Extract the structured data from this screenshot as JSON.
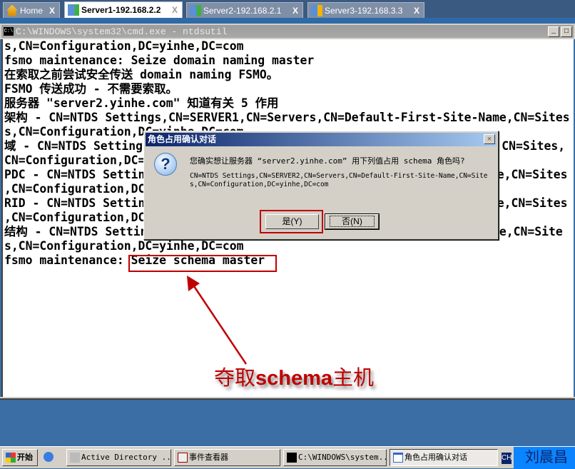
{
  "tabs": [
    {
      "label": "Home",
      "icon": "home-icon"
    },
    {
      "label": "Server1-192.168.2.2",
      "icon": "server-running-icon",
      "active": true
    },
    {
      "label": "Server2-192.168.2.1",
      "icon": "server-running-icon"
    },
    {
      "label": "Server3-192.168.3.3",
      "icon": "server-paused-icon"
    }
  ],
  "tab_close": "X",
  "cmd": {
    "title": "C:\\WINDOWS\\system32\\cmd.exe - ntdsutil",
    "icon_text": "C:\\",
    "lines": [
      "s,CN=Configuration,DC=yinhe,DC=com",
      "fsmo maintenance: Seize domain naming master",
      "在索取之前尝试安全传送 domain naming FSMO。",
      "FSMO 传送成功 - 不需要索取。",
      "服务器 \"server2.yinhe.com\" 知道有关 5 作用",
      "架构 - CN=NTDS Settings,CN=SERVER1,CN=Servers,CN=Default-First-Site-Name,CN=Sites",
      "s,CN=Configuration,DC=yinhe,DC=com",
      "域 - CN=NTDS Settings,CN=SERVER1,CN=Servers,CN=Default-First-Site-Name,CN=Sites,",
      "CN=Configuration,DC=yinhe,DC=com",
      "PDC - CN=NTDS Settings,CN=SERVER1,CN=Servers,CN=Default-First-Site-Name,CN=Sites",
      ",CN=Configuration,DC=yinhe,DC=com",
      "RID - CN=NTDS Settings,CN=SERVER1,CN=Servers,CN=Default-First-Site-Name,CN=Sites",
      ",CN=Configuration,DC=yinhe,DC=com",
      "结构 - CN=NTDS Settings,CN=SERVER1,CN=Servers,CN=Default-First-Site-Name,CN=Site",
      "s,CN=Configuration,DC=yinhe,DC=com",
      "fsmo maintenance: Seize schema master"
    ]
  },
  "dialog": {
    "title": "角色占用确认对话",
    "close": "×",
    "icon": "question-icon",
    "message": "您确实想让服务器 “server2.yinhe.com” 用下列值占用 schema 角色吗?",
    "dn": "CN=NTDS Settings,CN=SERVER2,CN=Servers,CN=Default-First-Site-Name,CN=Sites,CN=Configuration,DC=yinhe,DC=com",
    "yes": "是(Y)",
    "no": "否(N)"
  },
  "annotation": {
    "pre": "夺取",
    "mid": "schema",
    "post": "主机",
    "color": "#c00000"
  },
  "taskbar": {
    "start": "开始",
    "items": [
      "Active Directory ...",
      "事件查看器",
      "C:\\WINDOWS\\system...",
      "角色占用确认对话"
    ],
    "lang": "CH",
    "user": "刘晨昌"
  }
}
